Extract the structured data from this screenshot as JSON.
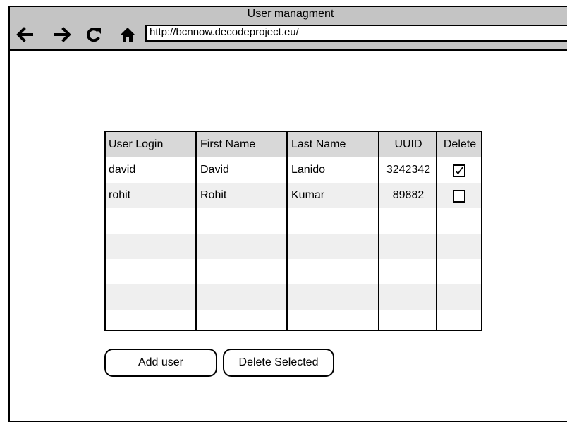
{
  "window": {
    "title": "User managment",
    "url": "http://bcnnow.decodeproject.eu/"
  },
  "nav": {
    "back_icon": "arrow-left-icon",
    "forward_icon": "arrow-right-icon",
    "reload_icon": "reload-icon",
    "home_icon": "home-icon"
  },
  "table": {
    "headers": [
      "User Login",
      "First Name",
      "Last Name",
      "UUID",
      "Delete"
    ],
    "rows": [
      {
        "login": "david",
        "first": "David",
        "last": "Lanido",
        "uuid": "3242342",
        "delete": true
      },
      {
        "login": "rohit",
        "first": "Rohit",
        "last": "Kumar",
        "uuid": "89882",
        "delete": false
      }
    ]
  },
  "actions": {
    "add_label": "Add user",
    "delete_label": "Delete Selected"
  }
}
